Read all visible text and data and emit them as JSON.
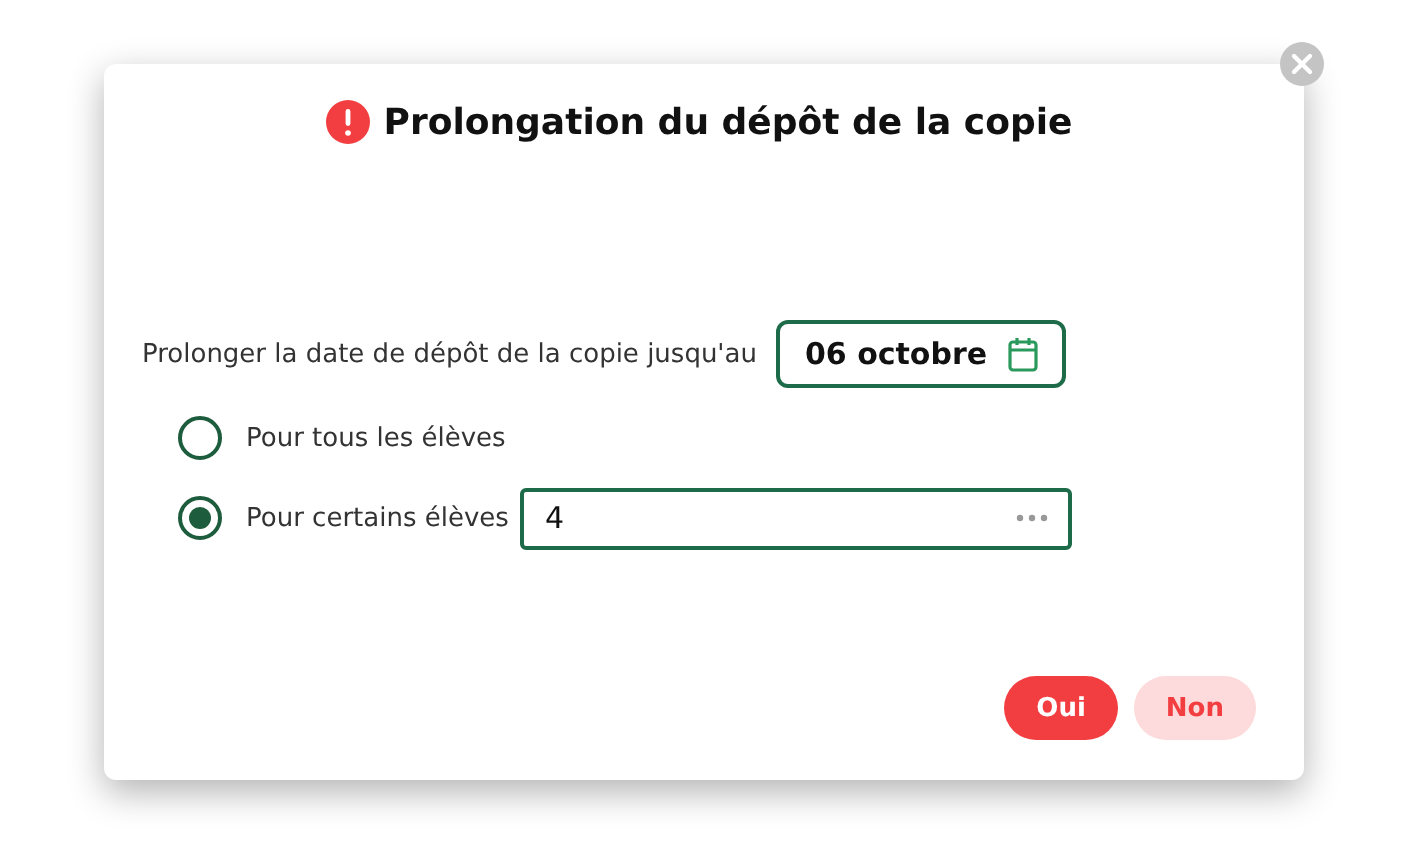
{
  "dialog": {
    "title": "Prolongation du dépôt de la copie",
    "prompt": "Prolonger la date de dépôt de la copie jusqu'au",
    "date": {
      "value": "06 octobre"
    },
    "options": [
      {
        "label": "Pour tous les élèves",
        "selected": false
      },
      {
        "label": "Pour certains élèves",
        "selected": true,
        "value": "4"
      }
    ],
    "buttons": [
      {
        "label": "Oui",
        "kind": "primary"
      },
      {
        "label": "Non",
        "kind": "secondary"
      }
    ]
  }
}
